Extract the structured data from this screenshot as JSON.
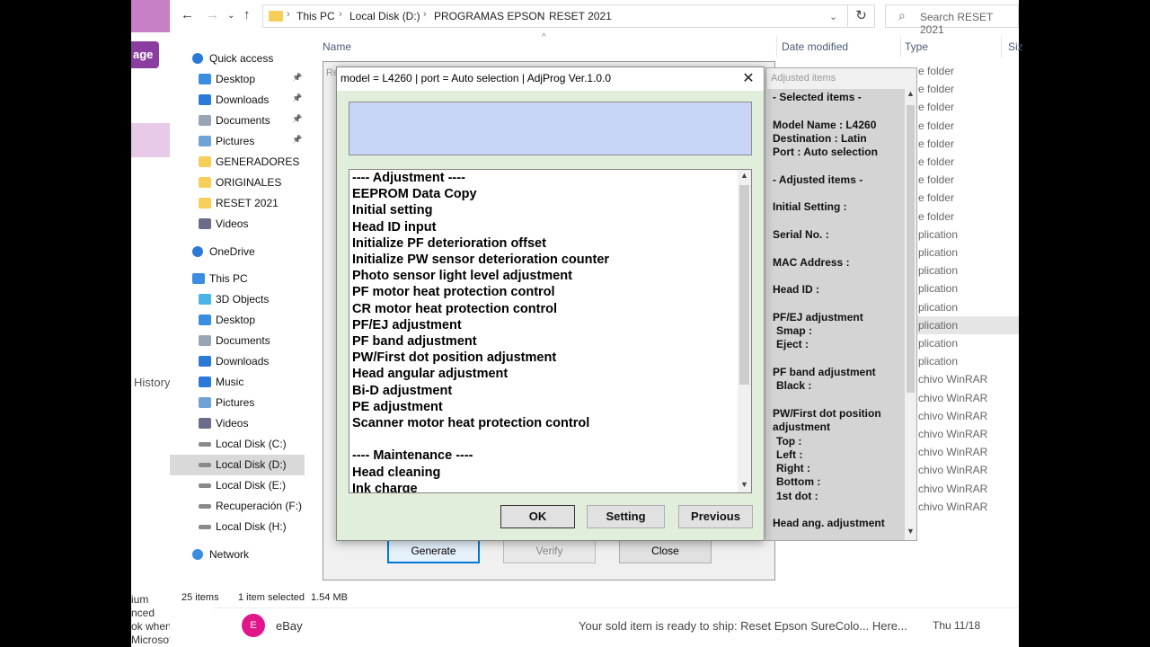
{
  "explorer": {
    "breadcrumbs": [
      "This PC",
      "Local Disk (D:)",
      "PROGRAMAS EPSON",
      "RESET 2021"
    ],
    "search_placeholder": "Search RESET 2021",
    "columns": [
      "Name",
      "Date modified",
      "Type",
      "Siz"
    ],
    "nav_items": [
      {
        "label": "Quick access",
        "icon": "star-icon"
      },
      {
        "label": "Desktop",
        "icon": "desktop-icon"
      },
      {
        "label": "Downloads",
        "icon": "download-icon"
      },
      {
        "label": "Documents",
        "icon": "document-icon"
      },
      {
        "label": "Pictures",
        "icon": "picture-icon"
      },
      {
        "label": "GENERADORES",
        "icon": "folder-icon"
      },
      {
        "label": "ORIGINALES",
        "icon": "folder-icon"
      },
      {
        "label": "RESET 2021",
        "icon": "folder-icon"
      },
      {
        "label": "Videos",
        "icon": "video-icon"
      },
      {
        "label": "OneDrive",
        "icon": "cloud-icon"
      },
      {
        "label": "This PC",
        "icon": "computer-icon"
      },
      {
        "label": "3D Objects",
        "icon": "cube-icon"
      },
      {
        "label": "Desktop",
        "icon": "desktop-icon"
      },
      {
        "label": "Documents",
        "icon": "document-icon"
      },
      {
        "label": "Downloads",
        "icon": "download-icon"
      },
      {
        "label": "Music",
        "icon": "music-icon"
      },
      {
        "label": "Pictures",
        "icon": "picture-icon"
      },
      {
        "label": "Videos",
        "icon": "video-icon"
      },
      {
        "label": "Local Disk (C:)",
        "icon": "drive-icon"
      },
      {
        "label": "Local Disk (D:)",
        "icon": "drive-icon",
        "selected": true
      },
      {
        "label": "Local Disk (E:)",
        "icon": "drive-icon"
      },
      {
        "label": "Recuperación (F:)",
        "icon": "drive-icon"
      },
      {
        "label": "Local Disk (H:)",
        "icon": "drive-icon"
      },
      {
        "label": "Network",
        "icon": "network-icon"
      }
    ],
    "type_fragments": [
      "e folder",
      "e folder",
      "e folder",
      "e folder",
      "e folder",
      "e folder",
      "e folder",
      "e folder",
      "e folder",
      "plication",
      "plication",
      "plication",
      "plication",
      "plication",
      "plication",
      "plication",
      "plication",
      "chivo WinRAR",
      "chivo WinRAR",
      "chivo WinRAR",
      "chivo WinRAR",
      "chivo WinRAR",
      "chivo WinRAR",
      "chivo WinRAR",
      "chivo WinRAR"
    ],
    "status": {
      "count": "25 items",
      "selected": "1 item selected",
      "size": "1.54 MB"
    }
  },
  "bg_app": {
    "button": "age",
    "history": "History",
    "bottom_text": "ium\nnced\nok when\nMicrosoft"
  },
  "mail": {
    "avatar": "E",
    "sender": "eBay",
    "subject": "Your sold item is ready to ship: Reset Epson SureColo...   Here...",
    "date": "Thu 11/18"
  },
  "main_dialog": {
    "title_fragment": "Re",
    "buttons": {
      "generate": "Generate",
      "verify": "Verify",
      "close": "Close"
    }
  },
  "adjusted_panel": {
    "title": "Adjusted items",
    "lines": [
      "- Selected items -",
      "",
      "Model Name : L4260",
      "Destination : Latin",
      "Port : Auto selection",
      "",
      "- Adjusted items -",
      "",
      "Initial Setting :",
      "",
      "Serial No. :",
      "",
      "MAC Address :",
      "",
      "Head ID :",
      "",
      "PF/EJ adjustment",
      " Smap :",
      " Eject :",
      "",
      "PF band adjustment",
      " Black :",
      "",
      "PW/First dot position",
      "adjustment",
      " Top :",
      " Left :",
      " Right :",
      " Bottom :",
      " 1st dot :",
      "",
      "Head ang. adjustment"
    ]
  },
  "front_dialog": {
    "title": "model = L4260 | port = Auto selection | AdjProg Ver.1.0.0",
    "items": [
      "---- Adjustment ----",
      "EEPROM Data Copy",
      "Initial setting",
      "Head ID input",
      "Initialize PF deterioration offset",
      "Initialize PW sensor deterioration counter",
      "Photo sensor light level adjustment",
      "PF motor heat protection control",
      "CR motor heat protection control",
      "PF/EJ adjustment",
      "PF band adjustment",
      "PW/First dot position adjustment",
      "Head angular adjustment",
      "Bi-D adjustment",
      "PE adjustment",
      "Scanner motor heat protection control",
      "",
      "---- Maintenance ----",
      "Head cleaning",
      "Ink charge"
    ],
    "buttons": {
      "ok": "OK",
      "setting": "Setting",
      "previous": "Previous"
    }
  },
  "colors": {
    "dialog_bg": "#e1eedc",
    "blue_box": "#c9d5f7",
    "accent": "#0078d7",
    "ebay_avatar": "#e2158a"
  }
}
